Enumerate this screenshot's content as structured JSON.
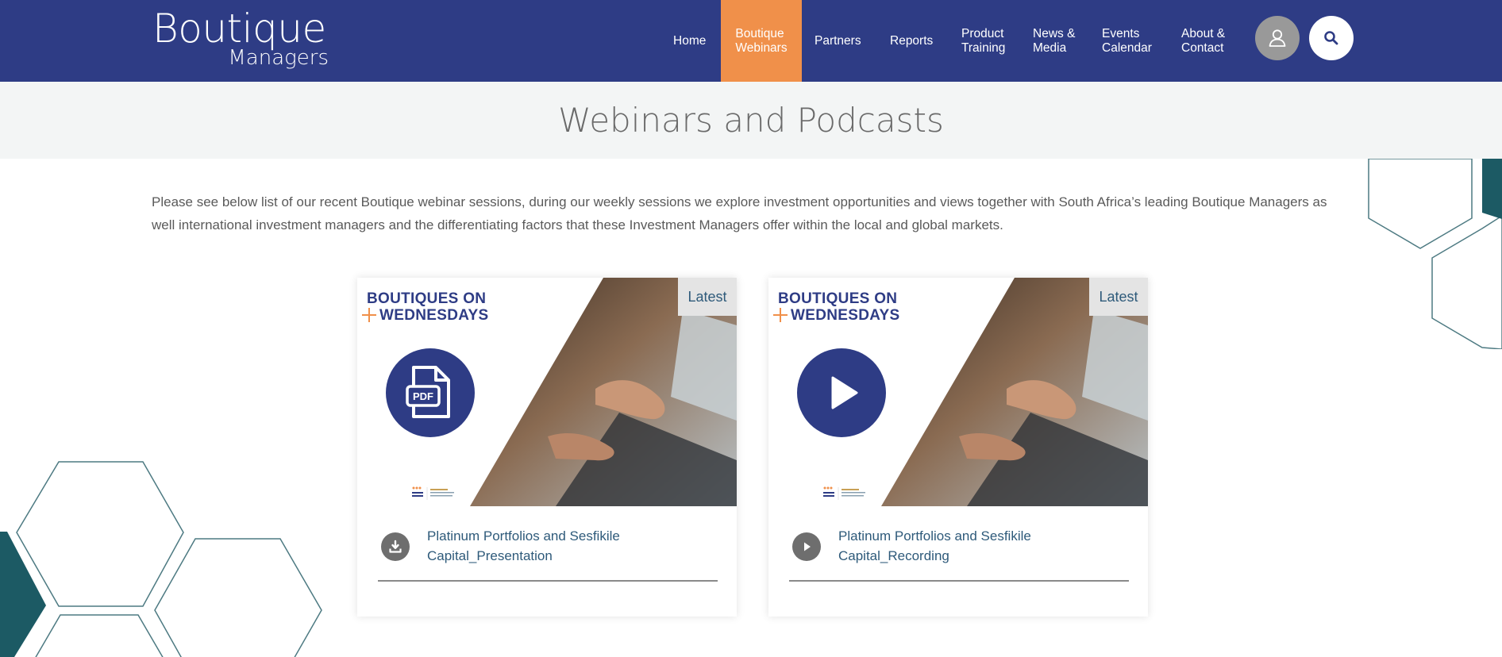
{
  "brand": {
    "logo_main": "Boutique",
    "logo_sub": "Managers"
  },
  "nav": {
    "items": [
      {
        "label": "Home",
        "active": false
      },
      {
        "label": "Boutique\nWebinars",
        "active": true
      },
      {
        "label": "Partners",
        "active": false
      },
      {
        "label": "Reports",
        "active": false
      },
      {
        "label": "Product\nTraining",
        "active": false
      },
      {
        "label": "News &\nMedia",
        "active": false
      },
      {
        "label": "Events\nCalendar",
        "active": false
      },
      {
        "label": "About &\nContact",
        "active": false
      }
    ]
  },
  "header_actions": {
    "user_icon": "user-icon",
    "search_icon": "search-icon"
  },
  "page": {
    "title": "Webinars and Podcasts",
    "intro": "Please see below list of our recent Boutique webinar sessions, during our weekly sessions we explore investment opportunities and views together with South Africa’s leading Boutique Managers as well international investment managers and the differentiating factors that these Investment Managers offer within the local and global markets."
  },
  "cards": [
    {
      "badge": "Latest",
      "banner_line1": "BOUTIQUES ON",
      "banner_line2": "WEDNESDAYS",
      "media_icon": "pdf-file-icon",
      "action_icon": "download-icon",
      "link": "Platinum Portfolios and Sesfikile Capital_Presentation"
    },
    {
      "badge": "Latest",
      "banner_line1": "BOUTIQUES ON",
      "banner_line2": "WEDNESDAYS",
      "media_icon": "play-icon",
      "action_icon": "play-icon",
      "link": "Platinum Portfolios and Sesfikile Capital_Recording"
    }
  ],
  "colors": {
    "header_bg": "#2e3c85",
    "nav_active": "#f0904a",
    "title_band": "#f3f5f5",
    "teal_accent": "#1c5a64",
    "link": "#2e5a7a"
  }
}
